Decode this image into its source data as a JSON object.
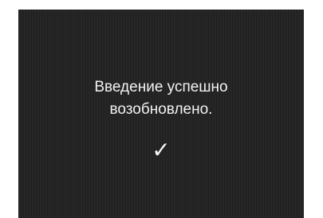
{
  "screen": {
    "message_line1": "Введение успешно",
    "message_line2": "возобновлено.",
    "status_icon": "checkmark-icon",
    "status_glyph": "✓",
    "colors": {
      "background": "#222222",
      "text": "#f2f2f2"
    }
  }
}
